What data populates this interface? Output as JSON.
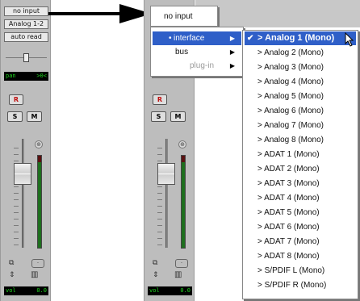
{
  "left_strip": {
    "input_slot": "no input",
    "output_slot": "Analog 1-2",
    "automation_mode": "auto read",
    "pan_label": "pan",
    "pan_value": ">0<",
    "record_button": "R",
    "solo_button": "S",
    "mute_button": "M",
    "volume_label": "vol",
    "volume_value": "0.0"
  },
  "right_strip": {
    "record_button": "R",
    "solo_button": "S",
    "mute_button": "M",
    "volume_label": "vol",
    "volume_value": "0.0"
  },
  "input_menu": {
    "no_input": "no input",
    "items": [
      {
        "label": "interface",
        "selected": true,
        "has_submenu": true,
        "disabled": false
      },
      {
        "label": "bus",
        "selected": false,
        "has_submenu": true,
        "disabled": false
      },
      {
        "label": "plug-in",
        "selected": false,
        "has_submenu": true,
        "disabled": true
      }
    ]
  },
  "interface_submenu": {
    "items": [
      "> Analog 1 (Mono)",
      "> Analog 2 (Mono)",
      "> Analog 3 (Mono)",
      "> Analog 4 (Mono)",
      "> Analog 5 (Mono)",
      "> Analog 6 (Mono)",
      "> Analog 7 (Mono)",
      "> Analog 8 (Mono)",
      "> ADAT 1 (Mono)",
      "> ADAT 2 (Mono)",
      "> ADAT 3 (Mono)",
      "> ADAT 4 (Mono)",
      "> ADAT 5 (Mono)",
      "> ADAT 6 (Mono)",
      "> ADAT 7 (Mono)",
      "> ADAT 8 (Mono)",
      "> S/PDIF L (Mono)",
      "> S/PDIF R (Mono)"
    ],
    "highlighted_index": 0,
    "checked_index": 0
  },
  "colors": {
    "highlight": "#2f5fc8",
    "strip_bg": "#bdbdbd",
    "display_text": "#1fd61f",
    "record_red": "#c01010"
  },
  "icons": {
    "callout": "arrow-right-icon",
    "check": "check-icon",
    "submenu": "triangle-right-icon",
    "cursor": "mouse-pointer-icon"
  }
}
